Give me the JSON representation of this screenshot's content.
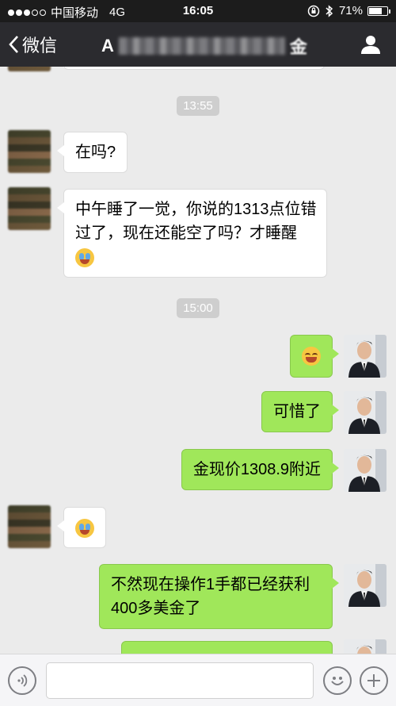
{
  "status_bar": {
    "carrier": "中国移动",
    "network": "4G",
    "time": "16:05",
    "battery_text": "71%",
    "battery_level": 0.71
  },
  "nav": {
    "back_label": "微信",
    "title_visible": "A",
    "title_end": "金",
    "user_icon": "person-icon"
  },
  "messages": {
    "timestamp_1": "13:55",
    "m1": "在吗?",
    "m2": "中午睡了一觉，你说的1313点位错过了，现在还能空了吗？才睡醒",
    "timestamp_2": "15:00",
    "m4": "可惜了",
    "m5": "金现价1308.9附近",
    "m7": "不然现在操作1手都已经获利400多美金了"
  },
  "input_bar": {
    "voice_icon": "voice-icon",
    "emoji_icon": "emoji-icon",
    "plus_icon": "plus-icon"
  },
  "colors": {
    "outgoing_bubble": "#a0e75a",
    "incoming_bubble": "#ffffff",
    "nav_background": "#2b2b2f"
  }
}
